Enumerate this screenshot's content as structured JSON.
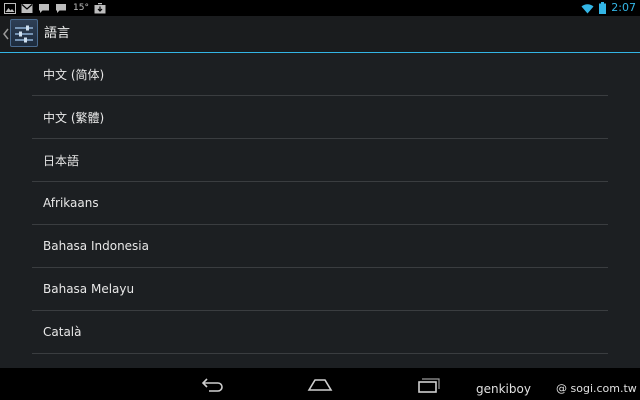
{
  "status_bar": {
    "temperature": "15°",
    "clock": "2:07",
    "icons": [
      "image-notification-icon",
      "gmail-icon",
      "chat-icon",
      "chat-icon",
      "download-icon",
      "wifi-icon",
      "battery-icon"
    ],
    "accent_color": "#33b5e5"
  },
  "action_bar": {
    "title": "語言",
    "icon": "settings-sliders-icon",
    "up_icon": "chevron-left-icon"
  },
  "languages": [
    "中文 (简体)",
    "中文 (繁體)",
    "日本語",
    "Afrikaans",
    "Bahasa Indonesia",
    "Bahasa Melayu",
    "Català"
  ],
  "nav_bar": {
    "icons": [
      "back-icon",
      "home-icon",
      "recent-apps-icon"
    ]
  },
  "watermark": {
    "left": "genkiboy",
    "right": "@ sogi.com.tw"
  }
}
